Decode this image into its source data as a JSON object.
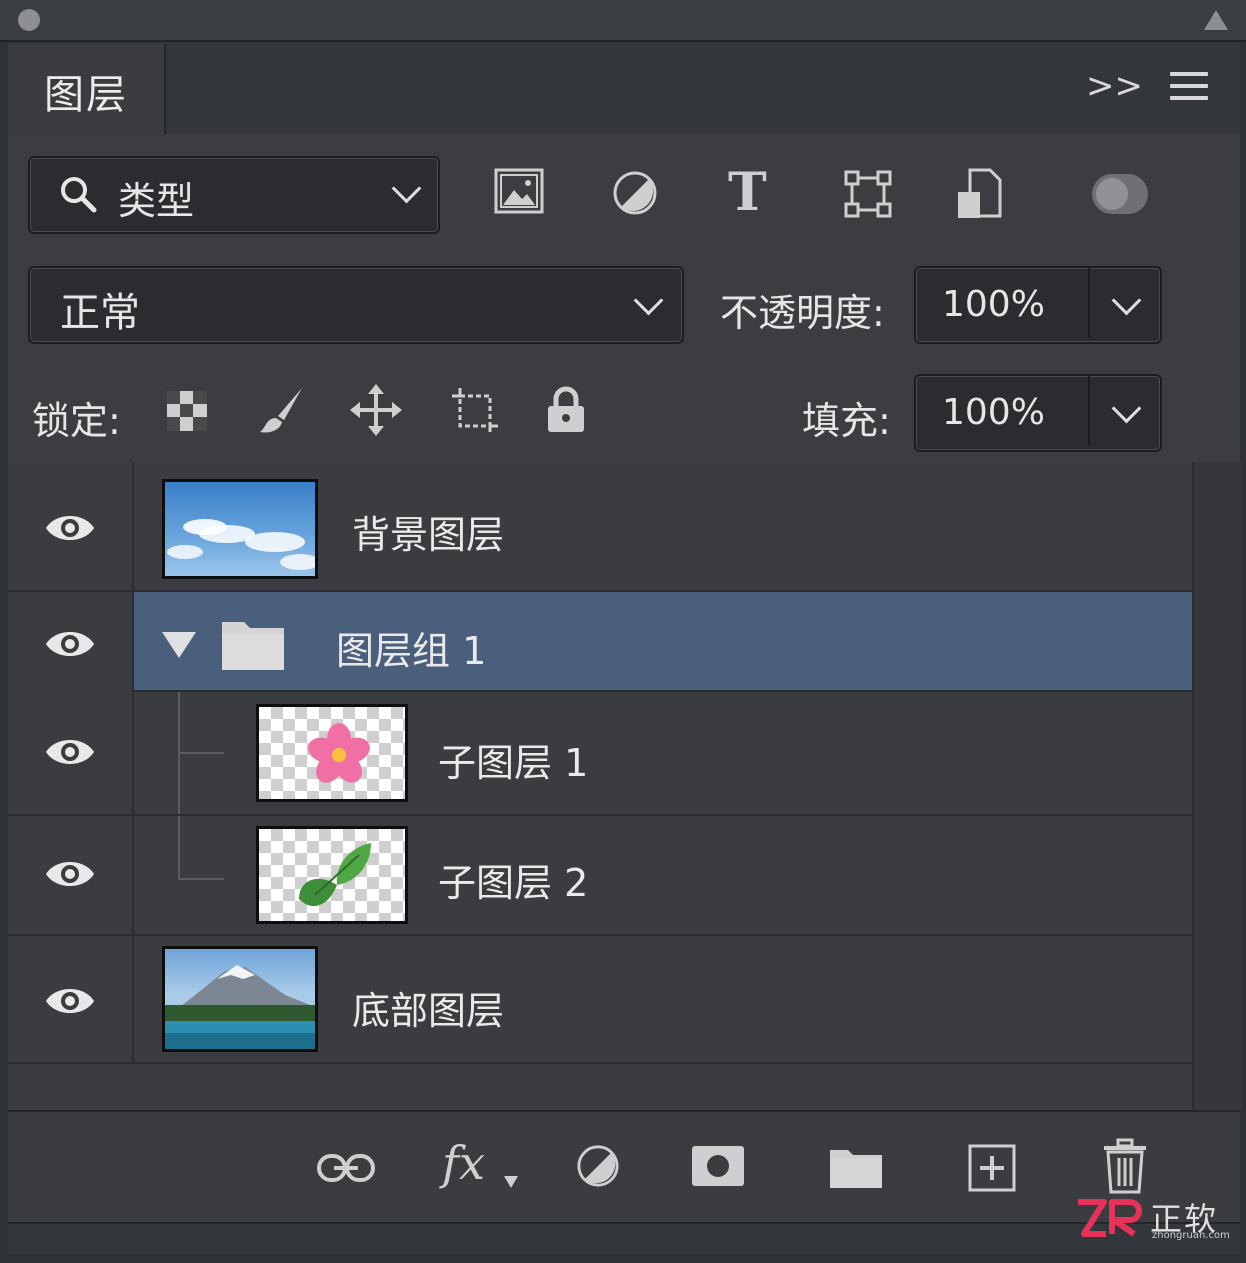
{
  "panel": {
    "tab_label": "图层",
    "expand_glyph": ">>"
  },
  "filter": {
    "label": "类型",
    "icons": [
      "image-icon",
      "adjustment-icon",
      "type-icon",
      "shape-icon",
      "smart-object-icon"
    ]
  },
  "blend": {
    "mode": "正常",
    "opacity_label": "不透明度:",
    "opacity_value": "100%"
  },
  "lock": {
    "label": "锁定:",
    "fill_label": "填充:",
    "fill_value": "100%",
    "icons": [
      "lock-transparent-icon",
      "lock-image-icon",
      "lock-position-icon",
      "lock-artboard-icon",
      "lock-all-icon"
    ]
  },
  "layers": [
    {
      "name": "背景图层",
      "type": "image",
      "visible": true
    },
    {
      "name": "图层组 1",
      "type": "group",
      "visible": true,
      "selected": true,
      "expanded": true
    },
    {
      "name": "子图层 1",
      "type": "child",
      "visible": true
    },
    {
      "name": "子图层 2",
      "type": "child",
      "visible": true
    },
    {
      "name": "底部图层",
      "type": "image",
      "visible": true
    }
  ],
  "bottom_bar": {
    "fx_label": "fx",
    "icons": [
      "link-icon",
      "fx-icon",
      "adjustment-icon",
      "mask-icon",
      "folder-icon",
      "new-layer-icon",
      "trash-icon"
    ]
  },
  "watermark": {
    "brand": "正软",
    "sub": "zhongruan.com"
  },
  "colors": {
    "panel_bg": "#3a3c40",
    "selected_row": "#4a5f7c",
    "field_bg": "#2a2c30"
  }
}
